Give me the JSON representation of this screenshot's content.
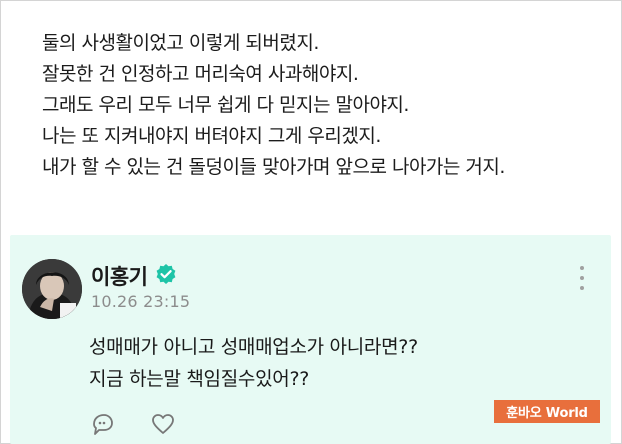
{
  "post": {
    "paragraph1": [
      "둘의 사생활이었고 이렇게 되버렸지.",
      "잘못한 건 인정하고 머리숙여 사과해야지.",
      "그래도 우리 모두 너무 쉽게 다 믿지는 말아야지."
    ],
    "paragraph2": [
      "나는 또 지켜내야지 버텨야지 그게 우리겠지.",
      "내가 할 수 있는 건 돌덩이들 맞아가며 앞으로 나아가는 거지."
    ]
  },
  "reply": {
    "author": "이홍기",
    "verified": true,
    "timestamp": "10.26 23:15",
    "body": [
      "성매매가 아니고 성매매업소가 아니라면??",
      "지금 하는말 책임질수있어??"
    ],
    "icons": {
      "verified": "verified-badge-icon",
      "more": "more-vertical-icon",
      "reply": "reply-icon",
      "like": "heart-icon"
    },
    "colors": {
      "card_background": "#e7faf4",
      "verified": "#1ec4a7"
    }
  },
  "watermark": "훈바오 World"
}
